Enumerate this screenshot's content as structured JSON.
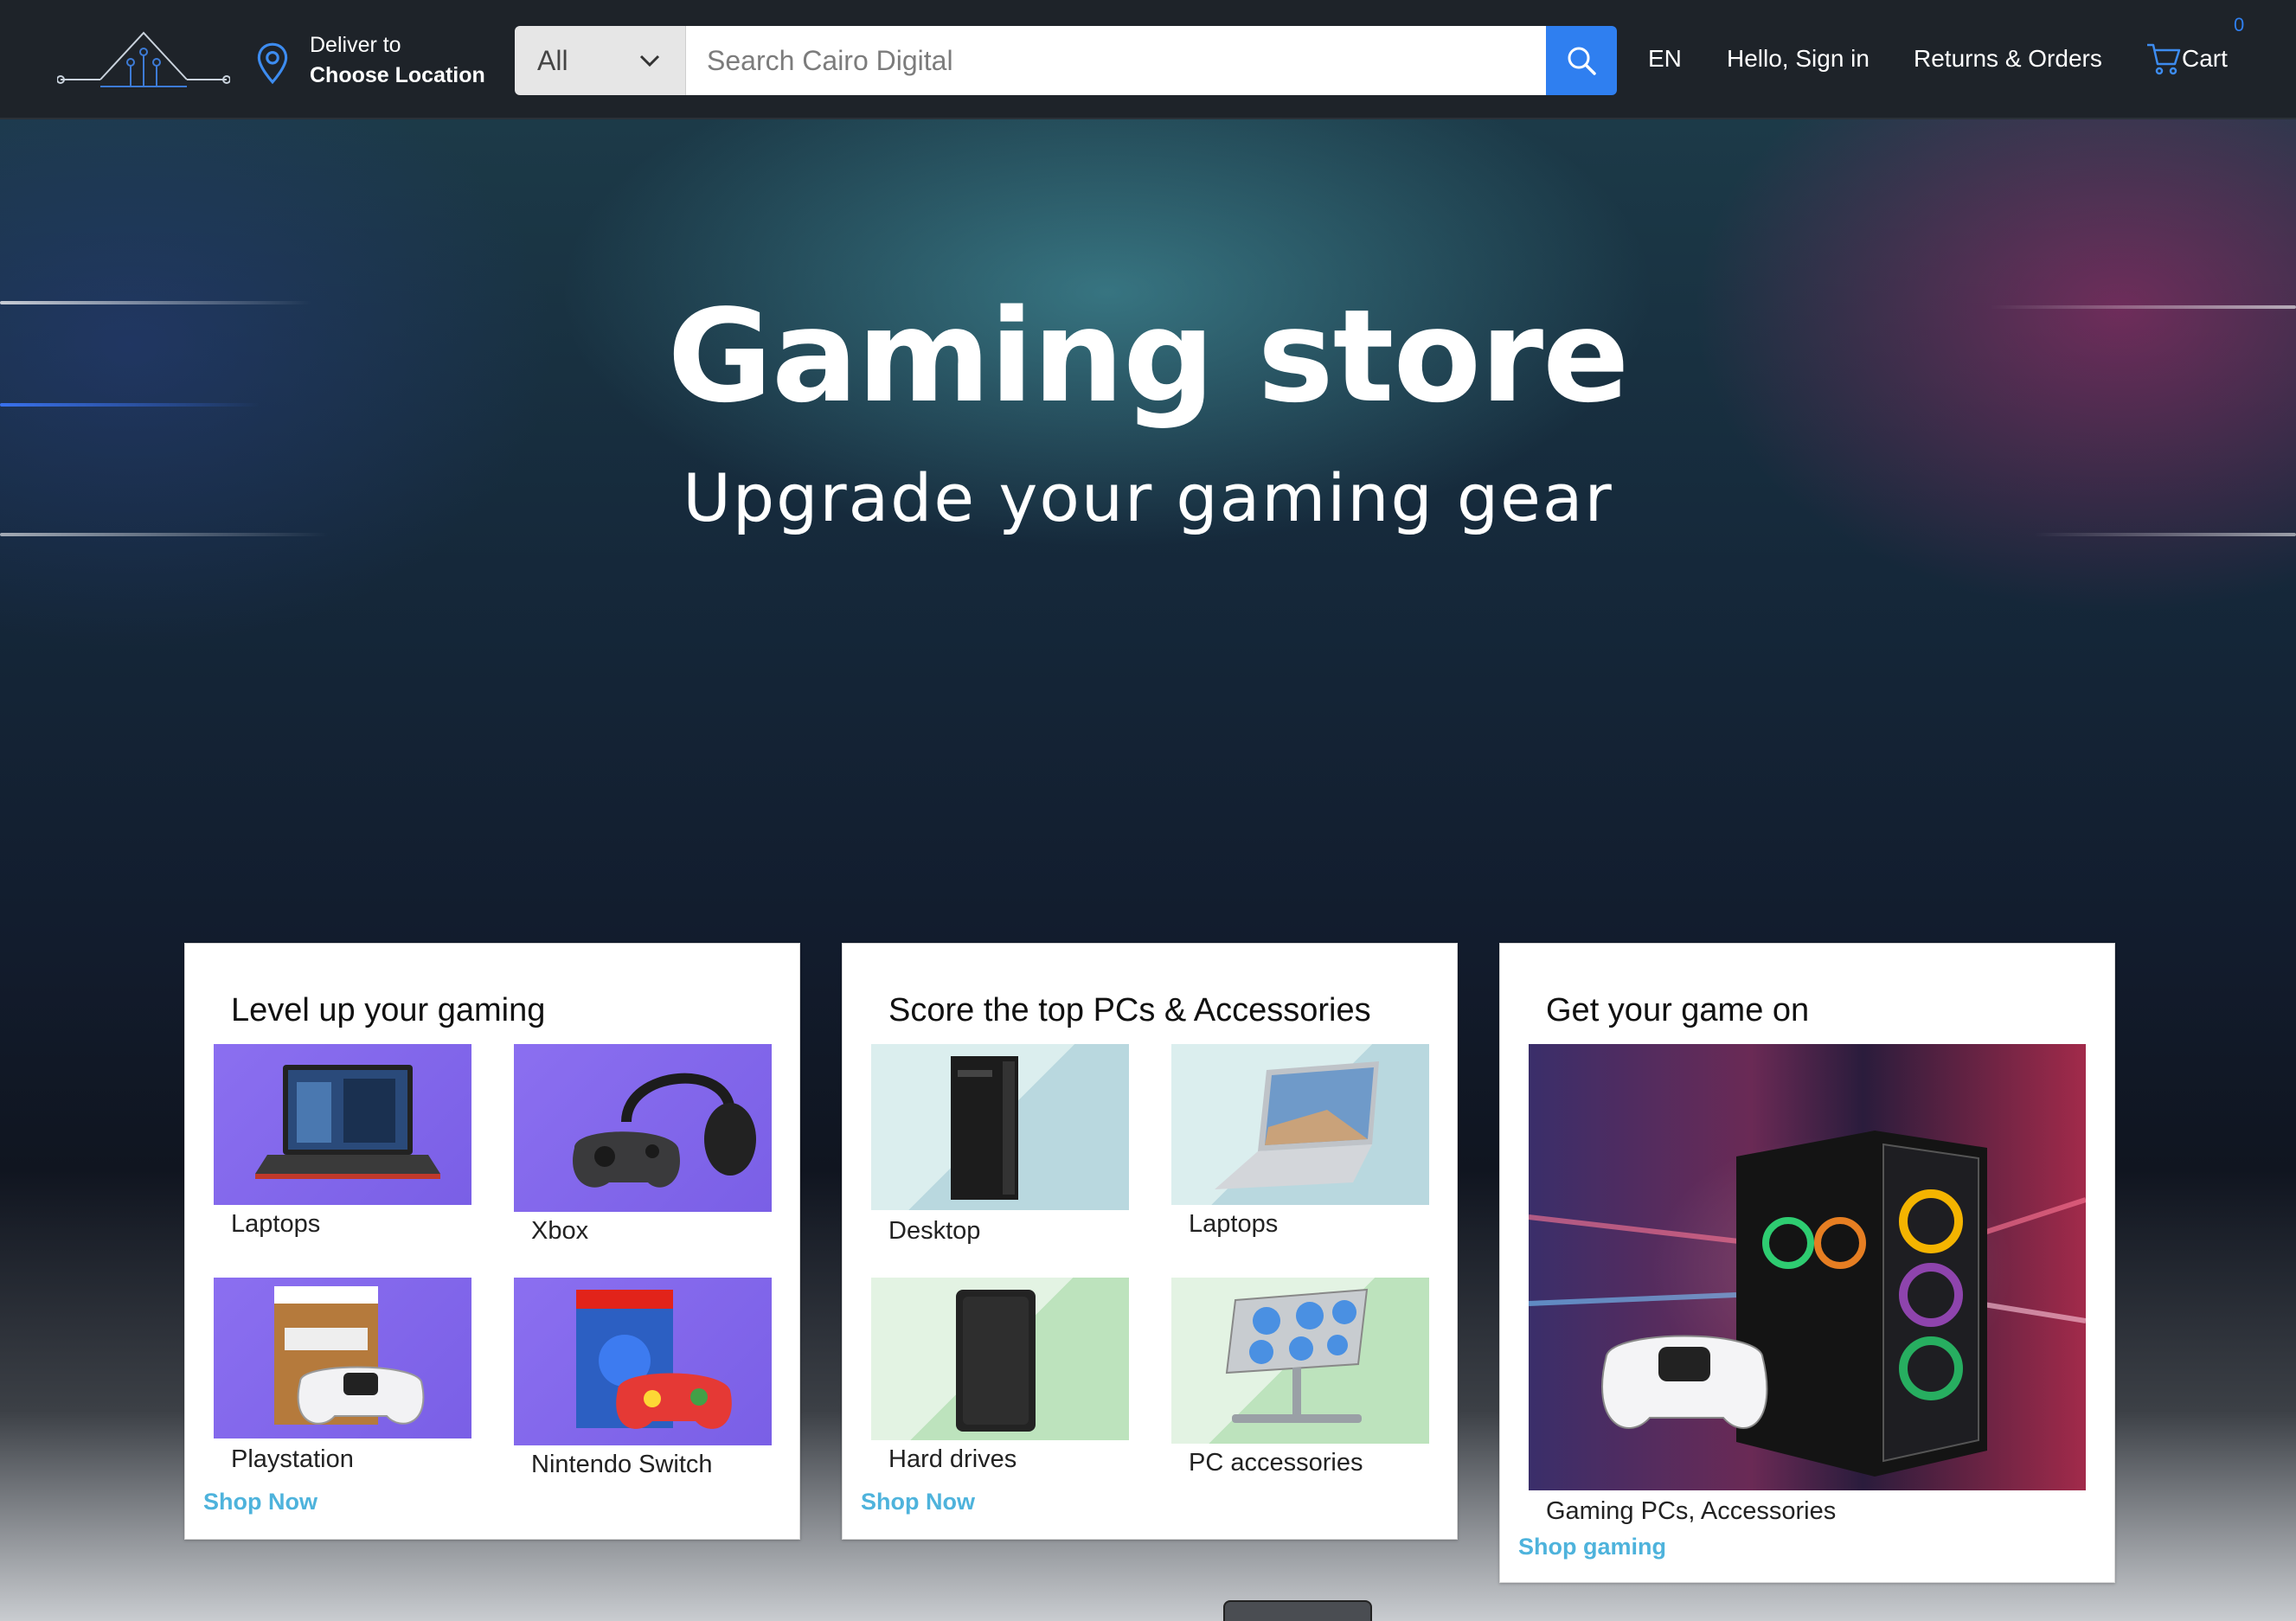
{
  "header": {
    "deliver_line1": "Deliver to",
    "deliver_line2": "Choose Location",
    "search_category": "All",
    "search_placeholder": "Search Cairo Digital",
    "language": "EN",
    "sign_in": "Hello, Sign in",
    "returns_orders": "Returns & Orders",
    "cart_label": "Cart",
    "cart_count": "0",
    "accent_color": "#2f7ff0"
  },
  "hero": {
    "title": "Gaming store",
    "subtitle": "Upgrade your gaming gear"
  },
  "cards": [
    {
      "title": "Level up your gaming",
      "tiles": [
        "Laptops",
        "Xbox",
        "Playstation",
        "Nintendo Switch"
      ],
      "link": "Shop Now"
    },
    {
      "title": "Score the top PCs & Accessories",
      "tiles": [
        "Desktop",
        "Laptops",
        "Hard drives",
        "PC accessories"
      ],
      "link": "Shop Now"
    },
    {
      "title": "Get your game on",
      "tiles": [
        "Gaming PCs, Accessories"
      ],
      "link": "Shop gaming"
    }
  ],
  "link_color": "#4eb3dc"
}
